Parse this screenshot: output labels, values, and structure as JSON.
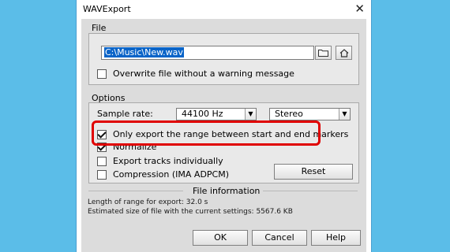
{
  "window": {
    "title": "WAVExport",
    "close_glyph": "✕"
  },
  "file_section": {
    "label": "File",
    "path_value": "C:\\Music\\New.wav",
    "overwrite_label": "Overwrite file without a warning message",
    "overwrite_checked": false,
    "browse_icon": "folder-icon",
    "home_icon": "home-icon"
  },
  "options_section": {
    "label": "Options",
    "sample_rate_label": "Sample rate:",
    "sample_rate_value": "44100 Hz",
    "channels_value": "Stereo",
    "only_range_label": "Only export the range between start and end markers",
    "only_range_checked": true,
    "normalize_label": "Normalize",
    "normalize_checked": true,
    "tracks_label": "Export tracks individually",
    "tracks_checked": false,
    "compression_label": "Compression (IMA ADPCM)",
    "compression_checked": false,
    "reset_label": "Reset"
  },
  "file_info": {
    "header": "File information",
    "length_line": "Length of range for export: 32.0 s",
    "size_line": "Estimated size of file with the current settings: 5567.6 KB"
  },
  "buttons": {
    "ok": "OK",
    "cancel": "Cancel",
    "help": "Help"
  },
  "colors": {
    "highlight": "#e00000",
    "selection": "#0a64c8",
    "background": "#5bbde8"
  }
}
